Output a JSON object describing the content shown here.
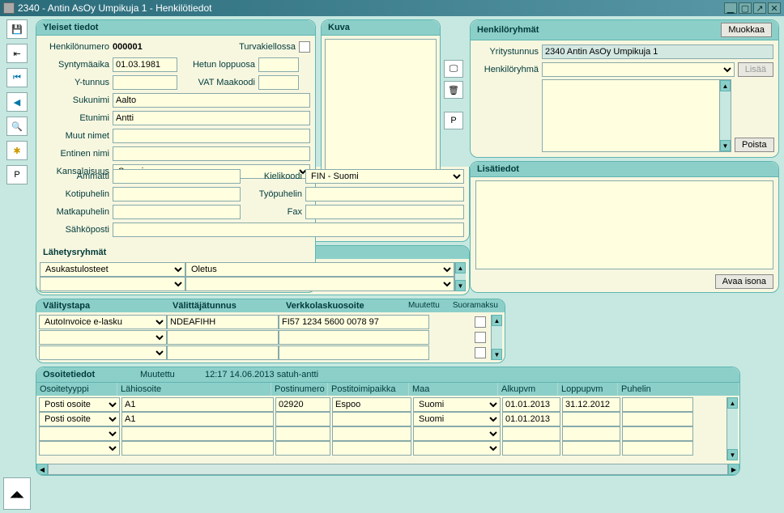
{
  "window": {
    "title": "2340 - Antin AsOy Umpikuja 1 - Henkilötiedot"
  },
  "yleiset": {
    "header": "Yleiset tiedot",
    "henkilonumero_lbl": "Henkilönumero",
    "henkilonumero": "000001",
    "turvakielto_lbl": "Turvakiellossa",
    "syntymaaika_lbl": "Syntymäaika",
    "syntymaaika": "01.03.1981",
    "hetun_lbl": "Hetun loppuosa",
    "hetun": "",
    "ytunnus_lbl": "Y-tunnus",
    "ytunnus": "",
    "vat_lbl": "VAT Maakoodi",
    "vat": "",
    "sukunimi_lbl": "Sukunimi",
    "sukunimi": "Aalto",
    "etunimi_lbl": "Etunimi",
    "etunimi": "Antti",
    "muutnimet_lbl": "Muut nimet",
    "muutnimet": "",
    "entinen_lbl": "Entinen nimi",
    "entinen": "",
    "kansalaisuus_lbl": "Kansalaisuus",
    "kansalaisuus": "Suomi",
    "ammatti_lbl": "Ammatti",
    "ammatti": "",
    "kielikoodi_lbl": "Kielikoodi",
    "kielikoodi": "FIN - Suomi",
    "kotipuhelin_lbl": "Kotipuhelin",
    "kotipuhelin": "",
    "tyopuhelin_lbl": "Työpuhelin",
    "tyopuhelin": "",
    "matkapuhelin_lbl": "Matkapuhelin",
    "matkapuhelin": "",
    "fax_lbl": "Fax",
    "fax": "",
    "sahkoposti_lbl": "Sähköposti",
    "sahkoposti": ""
  },
  "kuva": {
    "header": "Kuva",
    "p_btn": "P"
  },
  "hr": {
    "header": "Henkilöryhmät",
    "muokkaa": "Muokkaa",
    "yritystunnus_lbl": "Yritystunnus",
    "yritystunnus": "2340 Antin AsOy Umpikuja 1",
    "henkiloryhma_lbl": "Henkilöryhmä",
    "lisaa": "Lisää",
    "poista": "Poista"
  },
  "lisatiedot": {
    "header": "Lisätiedot",
    "avaa_isona": "Avaa isona"
  },
  "lahetys": {
    "header": "Lähetysryhmät",
    "col1": "Asukastulosteet",
    "col2": "Oletus"
  },
  "valitys": {
    "col1_hdr": "Välitystapa",
    "col2_hdr": "Välittäjätunnus",
    "col3_hdr": "Verkkolaskuosoite",
    "muutettu_hdr": "Muutettu",
    "suoramaksu_hdr": "Suoramaksu",
    "col1": "AutoInvoice e-lasku",
    "col2": "NDEAFIHH",
    "col3": "FI57 1234 5600 0078 97"
  },
  "osoite": {
    "header": "Osoitetiedot",
    "muutettu_lbl": "Muutettu",
    "muutettu_val": "12:17 14.06.2013 satuh-antti",
    "hdr": {
      "tyyppi": "Osoitetyyppi",
      "lahiosoite": "Lähiosoite",
      "postinum": "Postinumero",
      "postitoimi": "Postitoimipaikka",
      "maa": "Maa",
      "alku": "Alkupvm",
      "loppu": "Loppupvm",
      "puhelin": "Puhelin"
    },
    "rows": [
      {
        "tyyppi": "Posti osoite",
        "lahiosoite": "A1",
        "postinum": "02920",
        "postitoimi": "Espoo",
        "maa": "Suomi",
        "alku": "01.01.2013",
        "loppu": "31.12.2012",
        "puhelin": ""
      },
      {
        "tyyppi": "Posti osoite",
        "lahiosoite": "A1",
        "postinum": "",
        "postitoimi": "",
        "maa": "Suomi",
        "alku": "01.01.2013",
        "loppu": "",
        "puhelin": ""
      },
      {
        "tyyppi": "",
        "lahiosoite": "",
        "postinum": "",
        "postitoimi": "",
        "maa": "",
        "alku": "",
        "loppu": "",
        "puhelin": ""
      },
      {
        "tyyppi": "",
        "lahiosoite": "",
        "postinum": "",
        "postitoimi": "",
        "maa": "",
        "alku": "",
        "loppu": "",
        "puhelin": ""
      }
    ]
  },
  "sidebar_p": "P"
}
